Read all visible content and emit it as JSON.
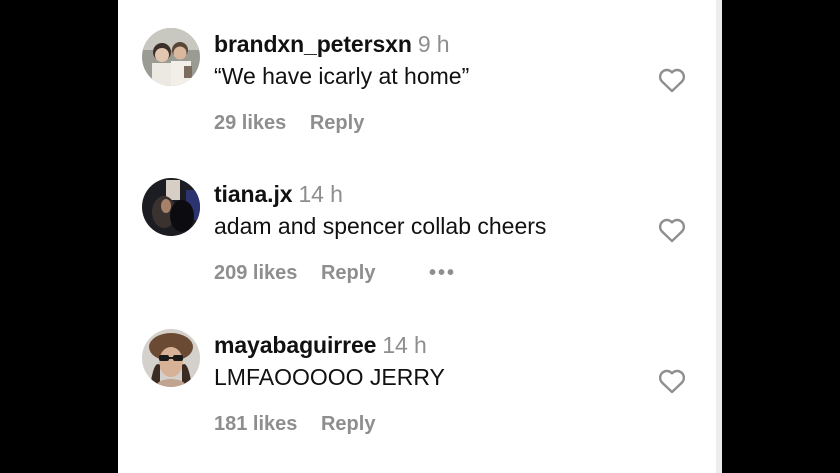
{
  "theme": {
    "accent_text": "#111111",
    "muted_text": "#8e8e8e"
  },
  "comments": [
    {
      "username": "brandxn_petersxn",
      "time": "9 h",
      "text": "“We have icarly at home”",
      "likes": "29 likes",
      "reply_label": "Reply",
      "avatar_icon": "avatar-photo",
      "heart_icon": "heart-outline-icon"
    },
    {
      "username": "tiana.jx",
      "time": "14 h",
      "text": "adam and spencer collab cheers",
      "likes": "209 likes",
      "reply_label": "Reply",
      "more_label": "•••",
      "avatar_icon": "avatar-photo",
      "heart_icon": "heart-outline-icon"
    },
    {
      "username": "mayabaguirree",
      "time": "14 h",
      "text": "LMFAOOOOO JERRY",
      "likes": "181 likes",
      "reply_label": "Reply",
      "avatar_icon": "avatar-photo",
      "heart_icon": "heart-outline-icon"
    }
  ]
}
